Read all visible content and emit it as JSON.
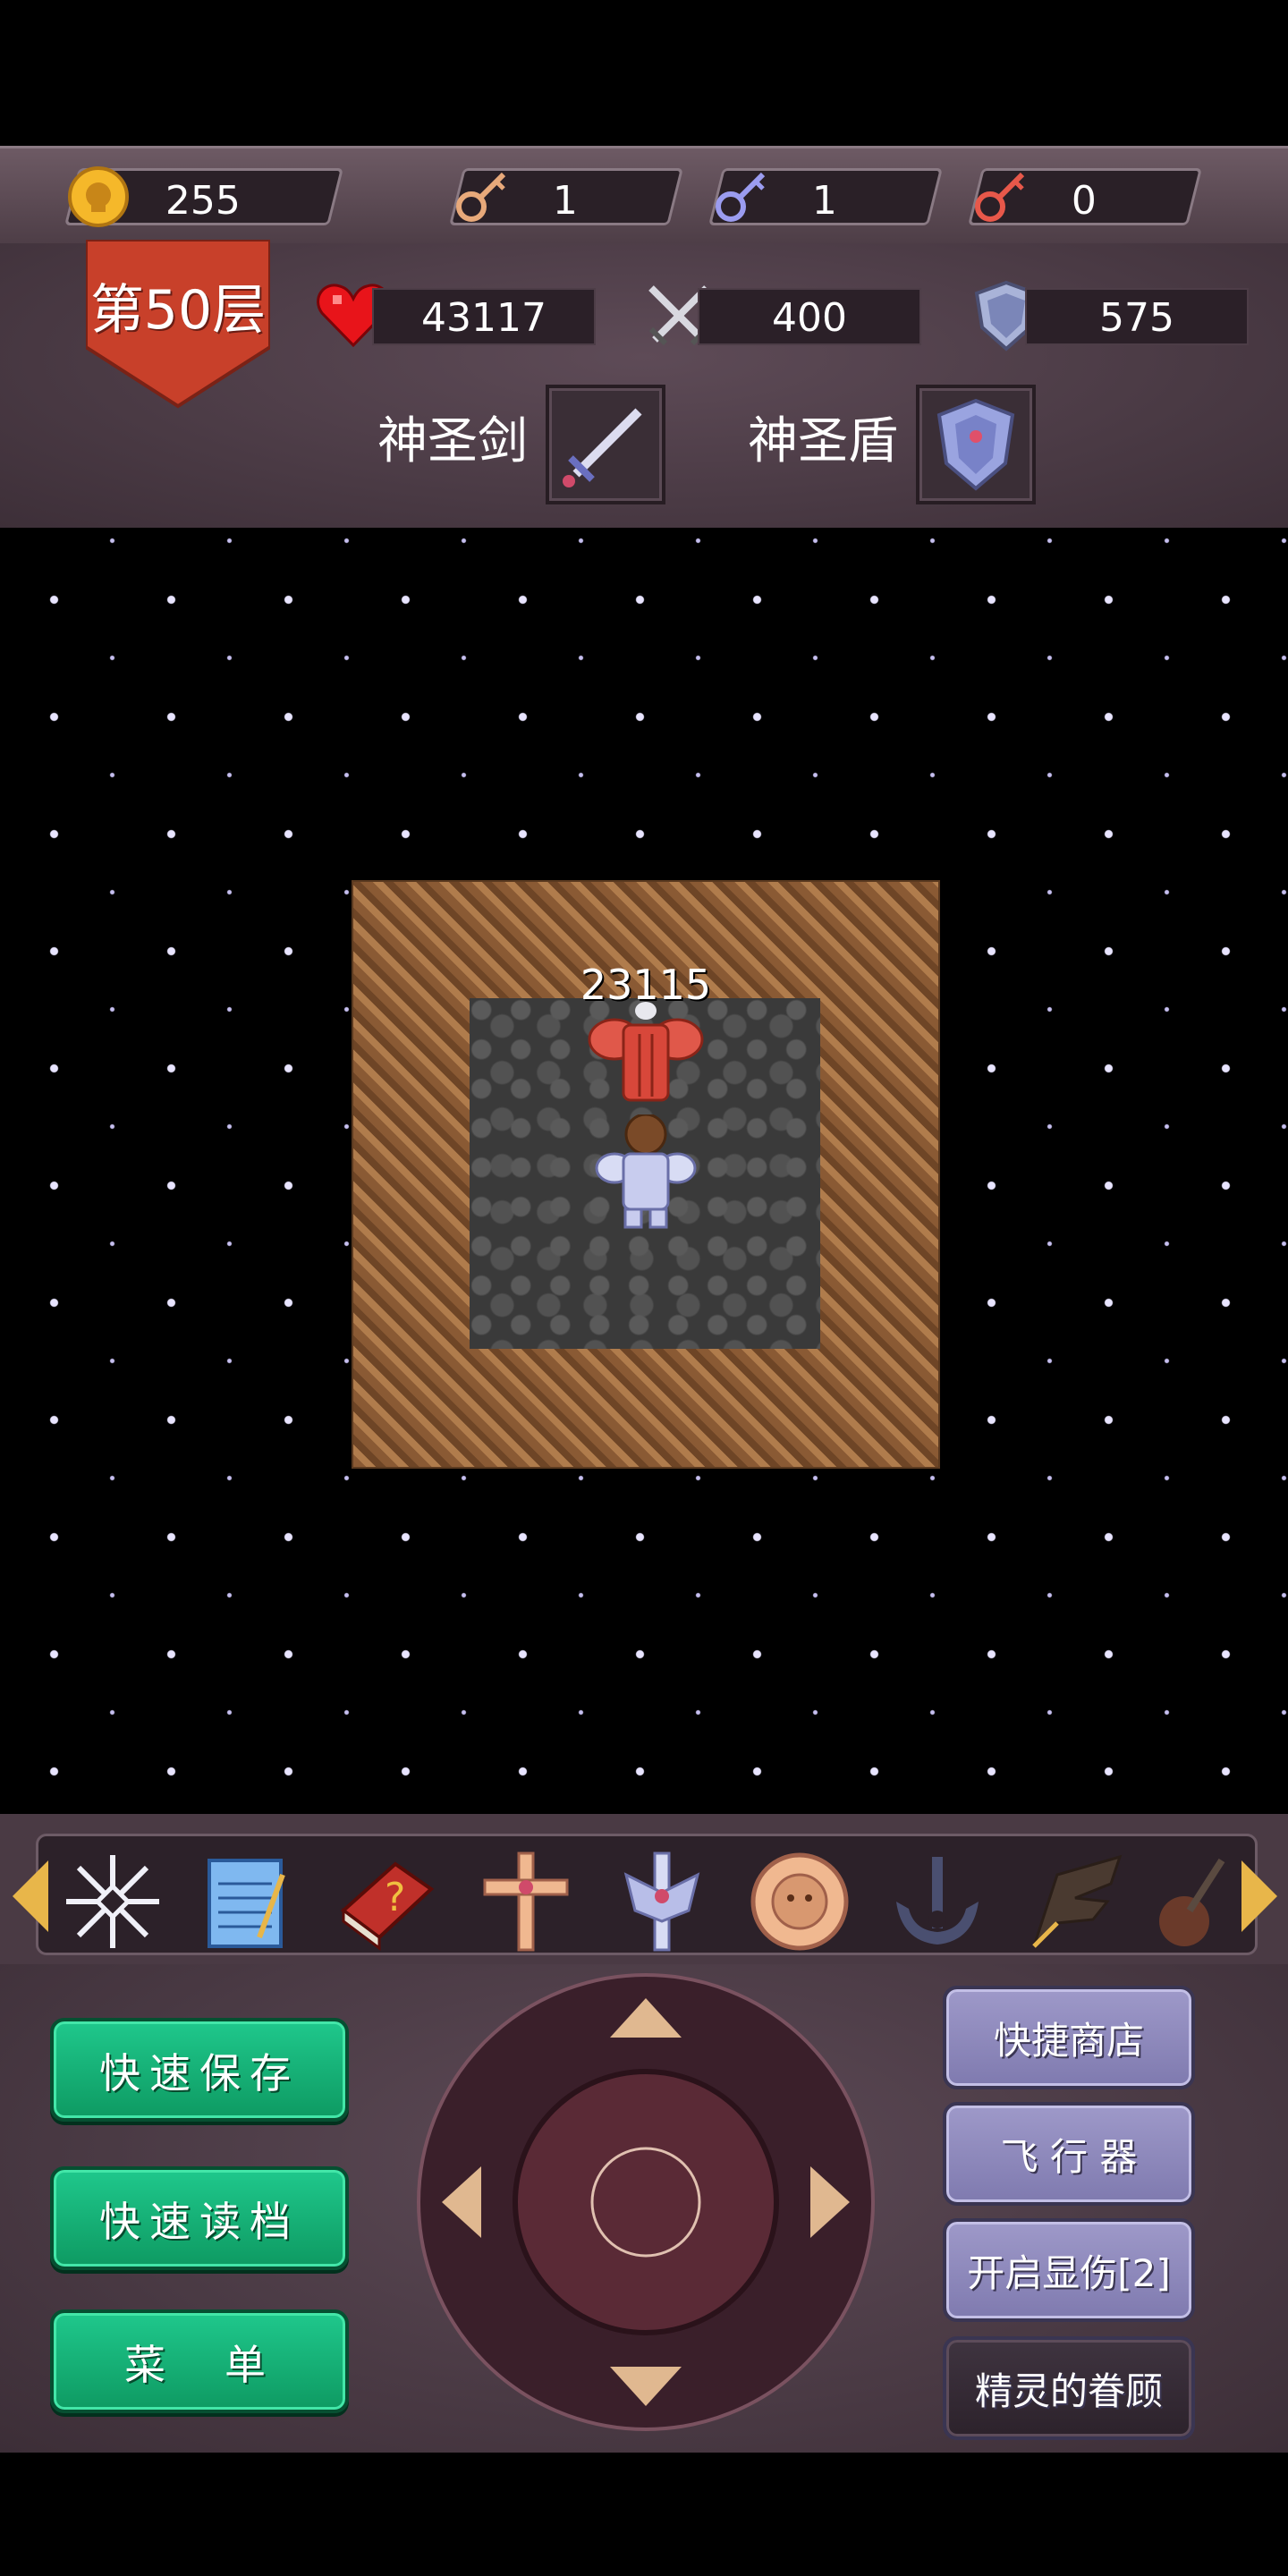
{
  "resources": {
    "gold": "255",
    "yellow_key": "1",
    "blue_key": "1",
    "red_key": "0"
  },
  "stats": {
    "floor_label": "第50层",
    "hp": "43117",
    "attack": "400",
    "defense": "575"
  },
  "equipment": {
    "weapon_label": "神圣剑",
    "shield_label": "神圣盾"
  },
  "map": {
    "damage_text": "23115"
  },
  "items": [
    "snowflake-icon",
    "notepad-icon",
    "monster-book-icon",
    "holy-cross-icon",
    "holy-sword-emblem-icon",
    "monkey-coin-icon",
    "anchor-icon",
    "wing-icon",
    "guitar-icon"
  ],
  "buttons": {
    "quick_save": "快速保存",
    "quick_load": "快速读档",
    "menu": "菜　单",
    "quick_shop": "快捷商店",
    "flyer": "飞 行 器",
    "show_damage": "开启显伤[2]",
    "fairy_blessing": "精灵的眷顾"
  },
  "colors": {
    "gold": "#e8b64a",
    "green_button": "#15b276",
    "purple_button": "#8f8abf",
    "panel_bg": "#4a3a44",
    "floor_banner": "#c8402a"
  }
}
